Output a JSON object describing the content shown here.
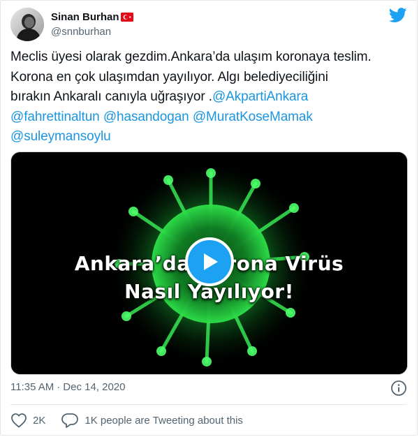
{
  "author": {
    "display_name": "Sinan Burhan",
    "handle": "@snnburhan",
    "flag_icon": "turkey-flag-icon"
  },
  "tweet": {
    "text_plain": "Meclis üyesi olarak gezdim.Ankara’da ulaşım koronaya teslim. Korona en çok ulaşımdan yayılıyor. Algı belediyeciliğini bırakın Ankaralı canıyla uğraşıyor .",
    "line1": "Meclis üyesi olarak gezdim.Ankara’da ulaşım koronaya teslim.",
    "line2": "Korona en çok ulaşımdan yayılıyor. Algı belediyeciliğini",
    "line3": "bırakın Ankaralı canıyla uğraşıyor .",
    "mentions": [
      "@AkpartiAnkara",
      "@fahrettinaltun",
      "@hasandogan",
      "@MuratKoseMamak",
      "@suleymansoylu"
    ]
  },
  "media": {
    "overlay_line1": "Ankara’da Korona Virüs",
    "overlay_line2": "Nasıl Yayılıyor!",
    "play_icon": "play-icon"
  },
  "meta": {
    "time": "11:35 AM",
    "separator": "·",
    "date": "Dec 14, 2020"
  },
  "actions": {
    "likes": "2K",
    "conversation": "1K people are Tweeting about this"
  },
  "colors": {
    "link": "#1b95e0",
    "twitter_blue": "#1da1f2",
    "like_red": "#e0245e",
    "muted": "#536471"
  }
}
